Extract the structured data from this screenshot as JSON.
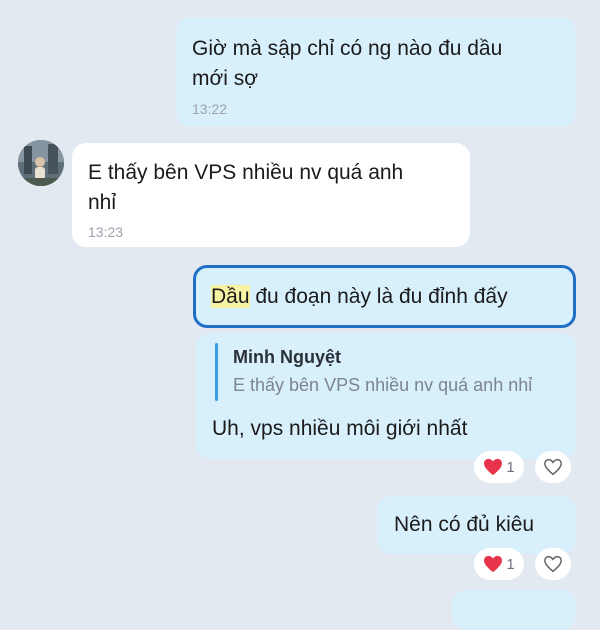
{
  "messages": {
    "m1": {
      "line1": "Giờ mà sập chỉ có ng nào đu dầu",
      "line2": "mới sợ",
      "time": "13:22"
    },
    "m2": {
      "line1": "E thấy bên VPS nhiều nv quá anh",
      "line2": "nhỉ",
      "time": "13:23"
    },
    "m3": {
      "highlight": "Dầu",
      "rest": " đu đoạn này là đu đỉnh đấy"
    },
    "m4": {
      "quote_name": "Minh Nguyệt",
      "quote_text": "E thấy bên VPS nhiều nv quá anh nhỉ",
      "text": "Uh, vps nhiều môi giới nhất",
      "reaction_count": "1"
    },
    "m5": {
      "text": "Nên có đủ kiêu",
      "reaction_count": "1"
    }
  },
  "colors": {
    "background": "#e2e9f1",
    "outgoing_bubble": "#d8effc",
    "incoming_bubble": "#ffffff",
    "selected_border": "#1f6fc6",
    "quote_bar": "#3a9ee8",
    "heart": "#e8344a"
  },
  "icons": {
    "reaction": "heart-icon",
    "like": "heart-outline-icon"
  }
}
